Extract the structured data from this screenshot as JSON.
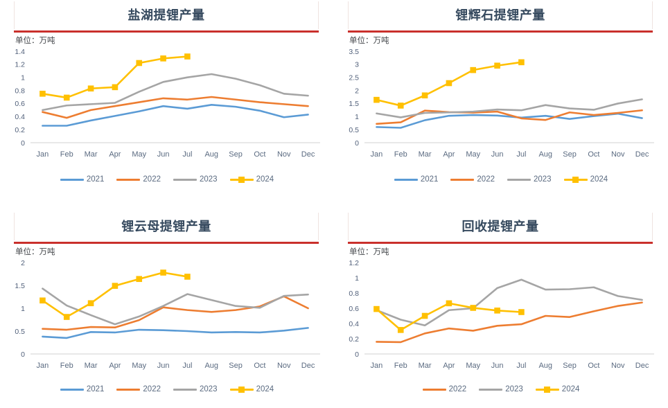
{
  "common": {
    "unit_label": "单位：万吨",
    "months": [
      "Jan",
      "Feb",
      "Mar",
      "Apr",
      "May",
      "Jun",
      "Jul",
      "Aug",
      "Sep",
      "Oct",
      "Nov",
      "Dec"
    ],
    "colors": {
      "series_2021": "#5b9bd5",
      "series_2022": "#ed7d31",
      "series_2023": "#a5a5a5",
      "series_2024": "#ffc000",
      "title_text": "#35495e",
      "title_rule": "#c9302c",
      "title_vline": "#efe3e0",
      "axis": "#d9d9d9",
      "tick_text": "#5a6a80"
    }
  },
  "panels": [
    {
      "id": "salt-lake",
      "title": "盐湖提锂产量",
      "unit_label": "单位：万吨",
      "legend": [
        {
          "label": "2021",
          "color": "#5b9bd5",
          "marker": false
        },
        {
          "label": "2022",
          "color": "#ed7d31",
          "marker": false
        },
        {
          "label": "2023",
          "color": "#a5a5a5",
          "marker": false
        },
        {
          "label": "2024",
          "color": "#ffc000",
          "marker": true
        }
      ],
      "chart_data": {
        "type": "line",
        "title": "盐湖提锂产量",
        "xlabel": "",
        "ylabel": "万吨",
        "ylim": [
          0,
          1.4
        ],
        "yticks": [
          0,
          0.2,
          0.4,
          0.6,
          0.8,
          1,
          1.2,
          1.4
        ],
        "ytick_labels": [
          "0",
          "0.2",
          "0.4",
          "0.6",
          "0.8",
          "1",
          "1.2",
          "1.4"
        ],
        "grid": false,
        "legend_position": "bottom",
        "categories": [
          "Jan",
          "Feb",
          "Mar",
          "Apr",
          "May",
          "Jun",
          "Jul",
          "Aug",
          "Sep",
          "Oct",
          "Nov",
          "Dec"
        ],
        "series": [
          {
            "name": "2021",
            "color": "#5b9bd5",
            "markers": false,
            "values": [
              0.26,
              0.26,
              0.34,
              0.41,
              0.48,
              0.56,
              0.52,
              0.58,
              0.55,
              0.49,
              0.39,
              0.43
            ]
          },
          {
            "name": "2022",
            "color": "#ed7d31",
            "markers": false,
            "values": [
              0.47,
              0.38,
              0.5,
              0.56,
              0.62,
              0.68,
              0.66,
              0.7,
              0.66,
              0.62,
              0.59,
              0.56
            ]
          },
          {
            "name": "2023",
            "color": "#a5a5a5",
            "markers": false,
            "values": [
              0.5,
              0.57,
              0.59,
              0.61,
              0.78,
              0.93,
              1.0,
              1.05,
              0.98,
              0.88,
              0.75,
              0.72
            ]
          },
          {
            "name": "2024",
            "color": "#ffc000",
            "markers": true,
            "values": [
              0.75,
              0.69,
              0.83,
              0.85,
              1.22,
              1.29,
              1.32,
              null,
              null,
              null,
              null,
              null
            ]
          }
        ]
      }
    },
    {
      "id": "spodumene",
      "title": "锂辉石提锂产量",
      "unit_label": "单位：万吨",
      "legend": [
        {
          "label": "2021",
          "color": "#5b9bd5",
          "marker": false
        },
        {
          "label": "2022",
          "color": "#ed7d31",
          "marker": false
        },
        {
          "label": "2023",
          "color": "#a5a5a5",
          "marker": false
        },
        {
          "label": "2024",
          "color": "#ffc000",
          "marker": true
        }
      ],
      "chart_data": {
        "type": "line",
        "title": "锂辉石提锂产量",
        "xlabel": "",
        "ylabel": "万吨",
        "ylim": [
          0,
          3.5
        ],
        "yticks": [
          0,
          0.5,
          1,
          1.5,
          2,
          2.5,
          3,
          3.5
        ],
        "ytick_labels": [
          "0",
          "0.5",
          "1",
          "1.5",
          "2",
          "2.5",
          "3",
          "3.5"
        ],
        "grid": false,
        "legend_position": "bottom",
        "categories": [
          "Jan",
          "Feb",
          "Mar",
          "Apr",
          "May",
          "Jun",
          "Jul",
          "Aug",
          "Sep",
          "Oct",
          "Nov",
          "Dec"
        ],
        "series": [
          {
            "name": "2021",
            "color": "#5b9bd5",
            "markers": false,
            "values": [
              0.6,
              0.57,
              0.86,
              1.03,
              1.06,
              1.04,
              0.96,
              1.03,
              0.91,
              1.02,
              1.11,
              0.94
            ]
          },
          {
            "name": "2022",
            "color": "#ed7d31",
            "markers": false,
            "values": [
              0.72,
              0.78,
              1.23,
              1.17,
              1.15,
              1.19,
              0.93,
              0.87,
              1.16,
              1.06,
              1.14,
              1.24
            ]
          },
          {
            "name": "2023",
            "color": "#a5a5a5",
            "markers": false,
            "values": [
              1.12,
              0.97,
              1.14,
              1.16,
              1.19,
              1.27,
              1.24,
              1.44,
              1.31,
              1.26,
              1.5,
              1.66
            ]
          },
          {
            "name": "2024",
            "color": "#ffc000",
            "markers": true,
            "values": [
              1.64,
              1.42,
              1.81,
              2.28,
              2.78,
              2.95,
              3.08,
              null,
              null,
              null,
              null,
              null
            ]
          }
        ]
      }
    },
    {
      "id": "lepidolite",
      "title": "锂云母提锂产量",
      "unit_label": "单位：万吨",
      "legend": [
        {
          "label": "2021",
          "color": "#5b9bd5",
          "marker": false
        },
        {
          "label": "2022",
          "color": "#ed7d31",
          "marker": false
        },
        {
          "label": "2023",
          "color": "#a5a5a5",
          "marker": false
        },
        {
          "label": "2024",
          "color": "#ffc000",
          "marker": true
        }
      ],
      "chart_data": {
        "type": "line",
        "title": "锂云母提锂产量",
        "xlabel": "",
        "ylabel": "万吨",
        "ylim": [
          0,
          2
        ],
        "yticks": [
          0,
          0.5,
          1,
          1.5,
          2
        ],
        "ytick_labels": [
          "0",
          "0.5",
          "1",
          "1.5",
          "2"
        ],
        "grid": false,
        "legend_position": "bottom",
        "categories": [
          "Jan",
          "Feb",
          "Mar",
          "Apr",
          "May",
          "Jun",
          "Jul",
          "Aug",
          "Sep",
          "Oct",
          "Nov",
          "Dec"
        ],
        "series": [
          {
            "name": "2021",
            "color": "#5b9bd5",
            "markers": false,
            "values": [
              0.38,
              0.35,
              0.48,
              0.47,
              0.53,
              0.52,
              0.5,
              0.47,
              0.48,
              0.47,
              0.51,
              0.57
            ]
          },
          {
            "name": "2022",
            "color": "#ed7d31",
            "markers": false,
            "values": [
              0.55,
              0.53,
              0.59,
              0.58,
              0.74,
              1.02,
              0.96,
              0.92,
              0.96,
              1.04,
              1.26,
              1.0
            ]
          },
          {
            "name": "2023",
            "color": "#a5a5a5",
            "markers": false,
            "values": [
              1.43,
              1.06,
              0.85,
              0.65,
              0.82,
              1.05,
              1.31,
              1.18,
              1.05,
              1.01,
              1.27,
              1.3
            ]
          },
          {
            "name": "2024",
            "color": "#ffc000",
            "markers": true,
            "values": [
              1.17,
              0.81,
              1.11,
              1.49,
              1.64,
              1.78,
              1.69,
              null,
              null,
              null,
              null,
              null
            ]
          }
        ]
      }
    },
    {
      "id": "recycling",
      "title": "回收提锂产量",
      "unit_label": "单位：万吨",
      "legend": [
        {
          "label": "2022",
          "color": "#ed7d31",
          "marker": false
        },
        {
          "label": "2023",
          "color": "#a5a5a5",
          "marker": false
        },
        {
          "label": "2024",
          "color": "#ffc000",
          "marker": true
        }
      ],
      "chart_data": {
        "type": "line",
        "title": "回收提锂产量",
        "xlabel": "",
        "ylabel": "万吨",
        "ylim": [
          0,
          1.2
        ],
        "yticks": [
          0,
          0.2,
          0.4,
          0.6,
          0.8,
          1,
          1.2
        ],
        "ytick_labels": [
          "0",
          "0.2",
          "0.4",
          "0.6",
          "0.8",
          "1",
          "1.2"
        ],
        "grid": false,
        "legend_position": "bottom",
        "categories": [
          "Jan",
          "Feb",
          "Mar",
          "Apr",
          "May",
          "Jun",
          "Jul",
          "Aug",
          "Sep",
          "Oct",
          "Nov",
          "Dec"
        ],
        "series": [
          {
            "name": "2022",
            "color": "#ed7d31",
            "markers": false,
            "values": [
              0.16,
              0.155,
              0.27,
              0.335,
              0.305,
              0.37,
              0.39,
              0.5,
              0.485,
              0.56,
              0.63,
              0.675
            ]
          },
          {
            "name": "2023",
            "color": "#a5a5a5",
            "markers": false,
            "values": [
              0.575,
              0.45,
              0.375,
              0.575,
              0.6,
              0.865,
              0.975,
              0.845,
              0.85,
              0.875,
              0.76,
              0.71
            ]
          },
          {
            "name": "2024",
            "color": "#ffc000",
            "markers": true,
            "values": [
              0.59,
              0.315,
              0.5,
              0.665,
              0.605,
              0.57,
              0.55,
              null,
              null,
              null,
              null,
              null
            ]
          }
        ]
      }
    }
  ]
}
